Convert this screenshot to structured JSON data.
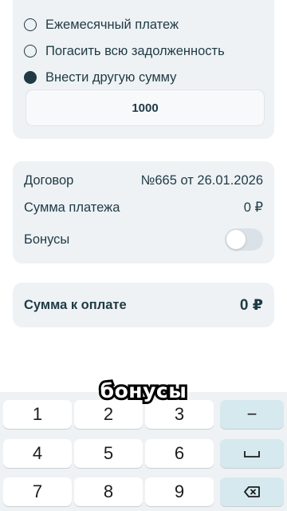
{
  "payment_options": [
    {
      "label": "Ежемесячный платеж",
      "checked": false
    },
    {
      "label": "Погасить всю задолженность",
      "checked": false
    },
    {
      "label": "Внести другую сумму",
      "checked": true
    }
  ],
  "amount_input": {
    "value": "1000"
  },
  "details": {
    "contract_label": "Договор",
    "contract_value": "№665 от 26.01.2026",
    "payment_sum_label": "Сумма платежа",
    "payment_sum_value": "0 ₽",
    "bonuses_label": "Бонусы",
    "bonuses_enabled": false
  },
  "total": {
    "label": "Сумма к оплате",
    "value": "0 ₽"
  },
  "caption": "бонусы",
  "keyboard": {
    "keys": [
      "1",
      "2",
      "3",
      "4",
      "5",
      "6",
      "7",
      "8",
      "9"
    ],
    "fn_keys": [
      "−",
      "␣",
      "⌫"
    ],
    "fn_icons": [
      "minus-icon",
      "space-icon",
      "backspace-icon"
    ]
  },
  "colors": {
    "accent": "#1f3a44",
    "card": "#eef2f5",
    "fn_key": "#d6e9ee"
  }
}
